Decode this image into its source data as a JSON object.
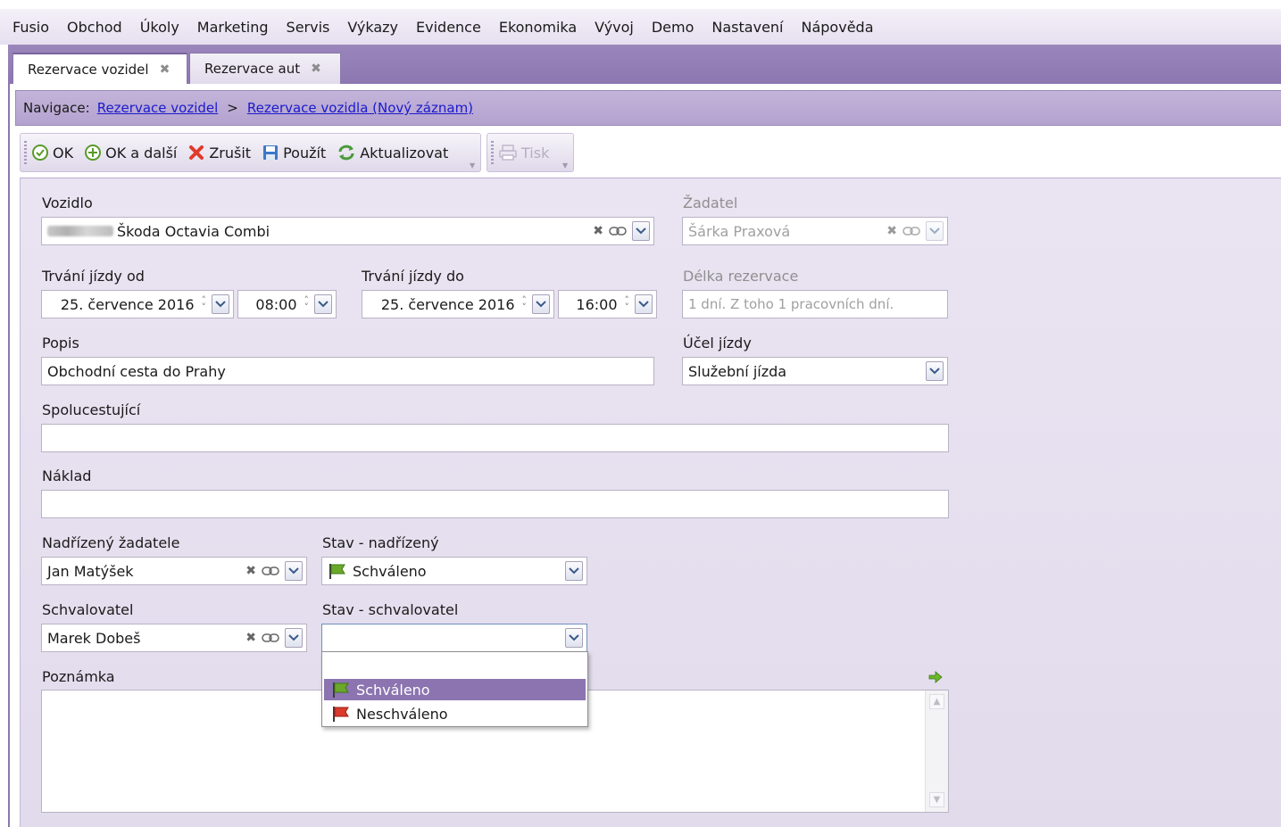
{
  "menu": [
    "Fusio",
    "Obchod",
    "Úkoly",
    "Marketing",
    "Servis",
    "Výkazy",
    "Evidence",
    "Ekonomika",
    "Vývoj",
    "Demo",
    "Nastavení",
    "Nápověda"
  ],
  "tabs": [
    {
      "label": "Rezervace vozidel",
      "active": true
    },
    {
      "label": "Rezervace aut",
      "active": false
    }
  ],
  "navigation": {
    "label": "Navigace:",
    "links": [
      "Rezervace vozidel",
      "Rezervace vozidla (Nový záznam)"
    ],
    "separator": ">"
  },
  "toolbar": {
    "ok": "OK",
    "ok_next": "OK a další",
    "cancel": "Zrušit",
    "apply": "Použít",
    "refresh": "Aktualizovat",
    "print": "Tisk"
  },
  "form": {
    "vehicle": {
      "label": "Vozidlo",
      "value": "Škoda Octavia Combi"
    },
    "applicant": {
      "label": "Žadatel",
      "value": "Šárka Praxová"
    },
    "from": {
      "label": "Trvání jízdy od",
      "date": "25. července 2016",
      "time": "08:00"
    },
    "to": {
      "label": "Trvání jízdy do",
      "date": "25. července 2016",
      "time": "16:00"
    },
    "length": {
      "label": "Délka rezervace",
      "value": "1 dní. Z toho 1 pracovních dní."
    },
    "description": {
      "label": "Popis",
      "value": "Obchodní cesta do Prahy"
    },
    "purpose": {
      "label": "Účel jízdy",
      "value": "Služební jízda"
    },
    "passengers": {
      "label": "Spolucestující",
      "value": ""
    },
    "cost": {
      "label": "Náklad",
      "value": ""
    },
    "supervisor": {
      "label": "Nadřízený žadatele",
      "value": "Jan Matýšek"
    },
    "supervisor_state": {
      "label": "Stav - nadřízený",
      "value": "Schváleno"
    },
    "approver": {
      "label": "Schvalovatel",
      "value": "Marek Dobeš"
    },
    "approver_state": {
      "label": "Stav - schvalovatel",
      "value": ""
    },
    "note": {
      "label": "Poznámka",
      "value": ""
    }
  },
  "dropdown_options": [
    "Schváleno",
    "Neschváleno"
  ],
  "colors": {
    "accent": "#8c74b0",
    "approved_flag": "#6aa82a",
    "rejected_flag": "#d93a2b",
    "link": "#1a1acc"
  }
}
